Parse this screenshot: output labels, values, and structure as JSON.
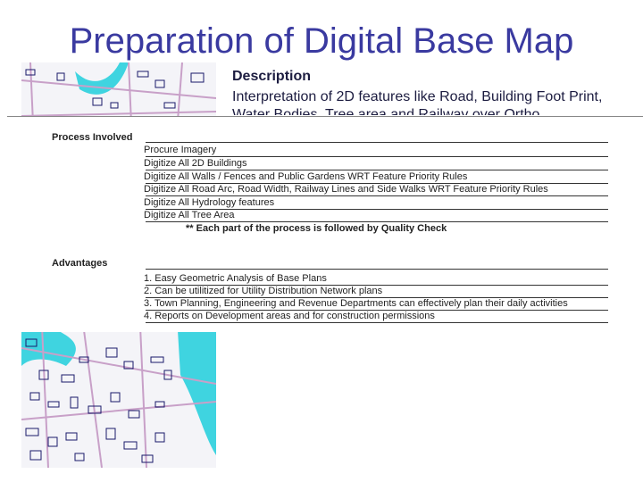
{
  "slide": {
    "title": "Preparation of Digital Base Map",
    "description_heading": "Description",
    "description_text": "Interpretation of 2D features like Road, Building Foot Print, Water Bodies, Tree area and Railway over Ortho"
  },
  "table": {
    "process_label": "Process Involved",
    "process_items": [
      "Procure Imagery",
      "Digitize All 2D Buildings",
      "Digitize All Walls / Fences and Public Gardens WRT Feature Priority Rules",
      "Digitize All Road Arc, Road Width, Railway Lines and Side Walks WRT Feature Priority Rules",
      "Digitize All Hydrology features",
      "Digitize All Tree Area"
    ],
    "quality_note": "** Each part of the process is followed by Quality Check",
    "advantages_label": "Advantages",
    "advantage_items": [
      "1. Easy Geometric Analysis of Base Plans",
      "2. Can be utilitized for Utility Distribution Network plans",
      "3. Town Planning, Engineering and Revenue Departments can effectively plan their daily activities",
      "4. Reports on Development areas and for construction permissions"
    ]
  },
  "colors": {
    "title": "#3a3aa0",
    "water": "#3fd4e0",
    "roads": "#c8a0c8",
    "buildings": "#1a1a6a"
  }
}
